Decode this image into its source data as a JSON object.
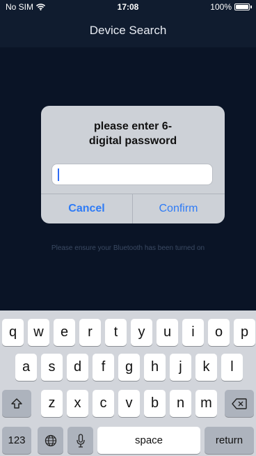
{
  "status": {
    "carrier": "No SIM",
    "time": "17:08",
    "battery": "100%"
  },
  "nav": {
    "title": "Device Search"
  },
  "main": {
    "hint": "Please ensure your Bluetooth has been turned on"
  },
  "dialog": {
    "title_line1": "please enter 6-",
    "title_line2": "digital password",
    "input_value": "",
    "cancel_label": "Cancel",
    "confirm_label": "Confirm"
  },
  "keyboard": {
    "row1": [
      "q",
      "w",
      "e",
      "r",
      "t",
      "y",
      "u",
      "i",
      "o",
      "p"
    ],
    "row2": [
      "a",
      "s",
      "d",
      "f",
      "g",
      "h",
      "j",
      "k",
      "l"
    ],
    "row3": [
      "z",
      "x",
      "c",
      "v",
      "b",
      "n",
      "m"
    ],
    "numbers_label": "123",
    "space_label": "space",
    "return_label": "return"
  },
  "colors": {
    "accent": "#2e7bf6",
    "background": "#0a1426",
    "nav_background": "#101c2f"
  }
}
